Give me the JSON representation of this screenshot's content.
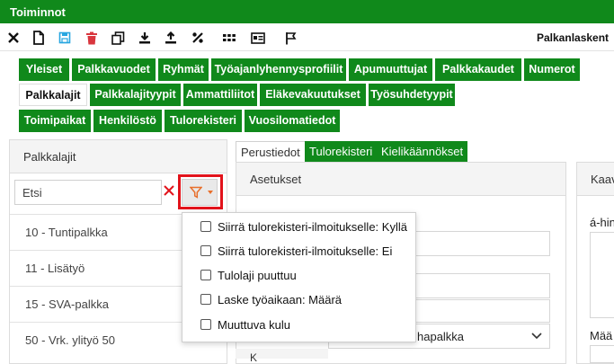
{
  "app": {
    "title": "Toiminnot",
    "company": "Palkanlaskent"
  },
  "toolbar": {
    "icons": [
      "close-icon",
      "new-document-icon",
      "save-icon",
      "delete-icon",
      "copy-icon",
      "download-icon",
      "upload-icon",
      "percent-icon",
      "more-icon",
      "card-icon",
      "flag-icon"
    ]
  },
  "nav": {
    "row1": [
      "Yleiset",
      "Palkkavuodet",
      "Ryhmät",
      "Työajanlyhennysprofiilit",
      "Apumuuttujat",
      "Palkkakaudet",
      "Numerot"
    ],
    "row2": [
      "Palkkalajit",
      "Palkkalajityypit",
      "Ammattiliitot",
      "Eläkevakuutukset",
      "Työsuhdetyypit"
    ],
    "row3": [
      "Toimipaikat",
      "Henkilöstö",
      "Tulorekisteri",
      "Vuosilomatiedot"
    ],
    "active": "Palkkalajit"
  },
  "left_panel": {
    "title": "Palkkalajit",
    "search_value": "Etsi",
    "items": [
      "10 - Tuntipalkka",
      "11 - Lisätyö",
      "15 - SVA-palkka",
      "50 - Vrk. ylityö 50"
    ]
  },
  "sub_tabs": [
    "Perustiedot",
    "Tulorekisteri",
    "Kielikäännökset"
  ],
  "main_panel": {
    "title": "Asetukset",
    "dropdown_value_fragment": "hapalkka",
    "label_fragment": "K"
  },
  "right_panel": {
    "title": "Kaav",
    "label1": "á-hin",
    "label2": "Mää"
  },
  "filter_menu": {
    "options": [
      "Siirrä tulorekisteri-ilmoitukselle: Kyllä",
      "Siirrä tulorekisteri-ilmoitukselle: Ei",
      "Tulolaji puuttuu",
      "Laske työaikaan: Määrä",
      "Muuttuva kulu"
    ]
  },
  "colors": {
    "brand": "#10891b",
    "highlight": "#e2131b",
    "filter_icon": "#e86f2b",
    "save_icon": "#27a6e0",
    "delete_icon": "#d9363e"
  }
}
